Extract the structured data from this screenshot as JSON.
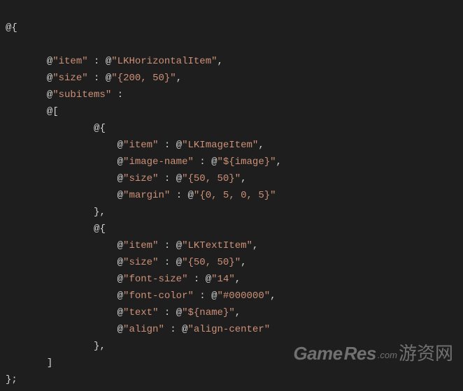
{
  "code": {
    "l01_open": "@{",
    "l02_blank": "",
    "l03": {
      "k": "item",
      "v": "LKHorizontalItem"
    },
    "l04": {
      "k": "size",
      "v": "{200, 50}"
    },
    "l05_key": "subitems",
    "l06_arr_open": "@[",
    "l07_obj_open": "@{",
    "l08": {
      "k": "item",
      "v": "LKImageItem"
    },
    "l09": {
      "k": "image-name",
      "v": "${image}"
    },
    "l10": {
      "k": "size",
      "v": "{50, 50}"
    },
    "l11": {
      "k": "margin",
      "v": "{0, 5, 0, 5}"
    },
    "l12_obj_close": "},",
    "l13_obj_open": "@{",
    "l14": {
      "k": "item",
      "v": "LKTextItem"
    },
    "l15": {
      "k": "size",
      "v": "{50, 50}"
    },
    "l16": {
      "k": "font-size",
      "v": "14"
    },
    "l17": {
      "k": "font-color",
      "v": "#000000"
    },
    "l18": {
      "k": "text",
      "v": "${name}"
    },
    "l19": {
      "k": "align",
      "v": "align-center"
    },
    "l20_obj_close": "},",
    "l21_arr_close": "]",
    "l22_close": "};"
  },
  "watermark": {
    "game": "Game",
    "res": "Res",
    "com": ".com",
    "cn": "游资网"
  }
}
